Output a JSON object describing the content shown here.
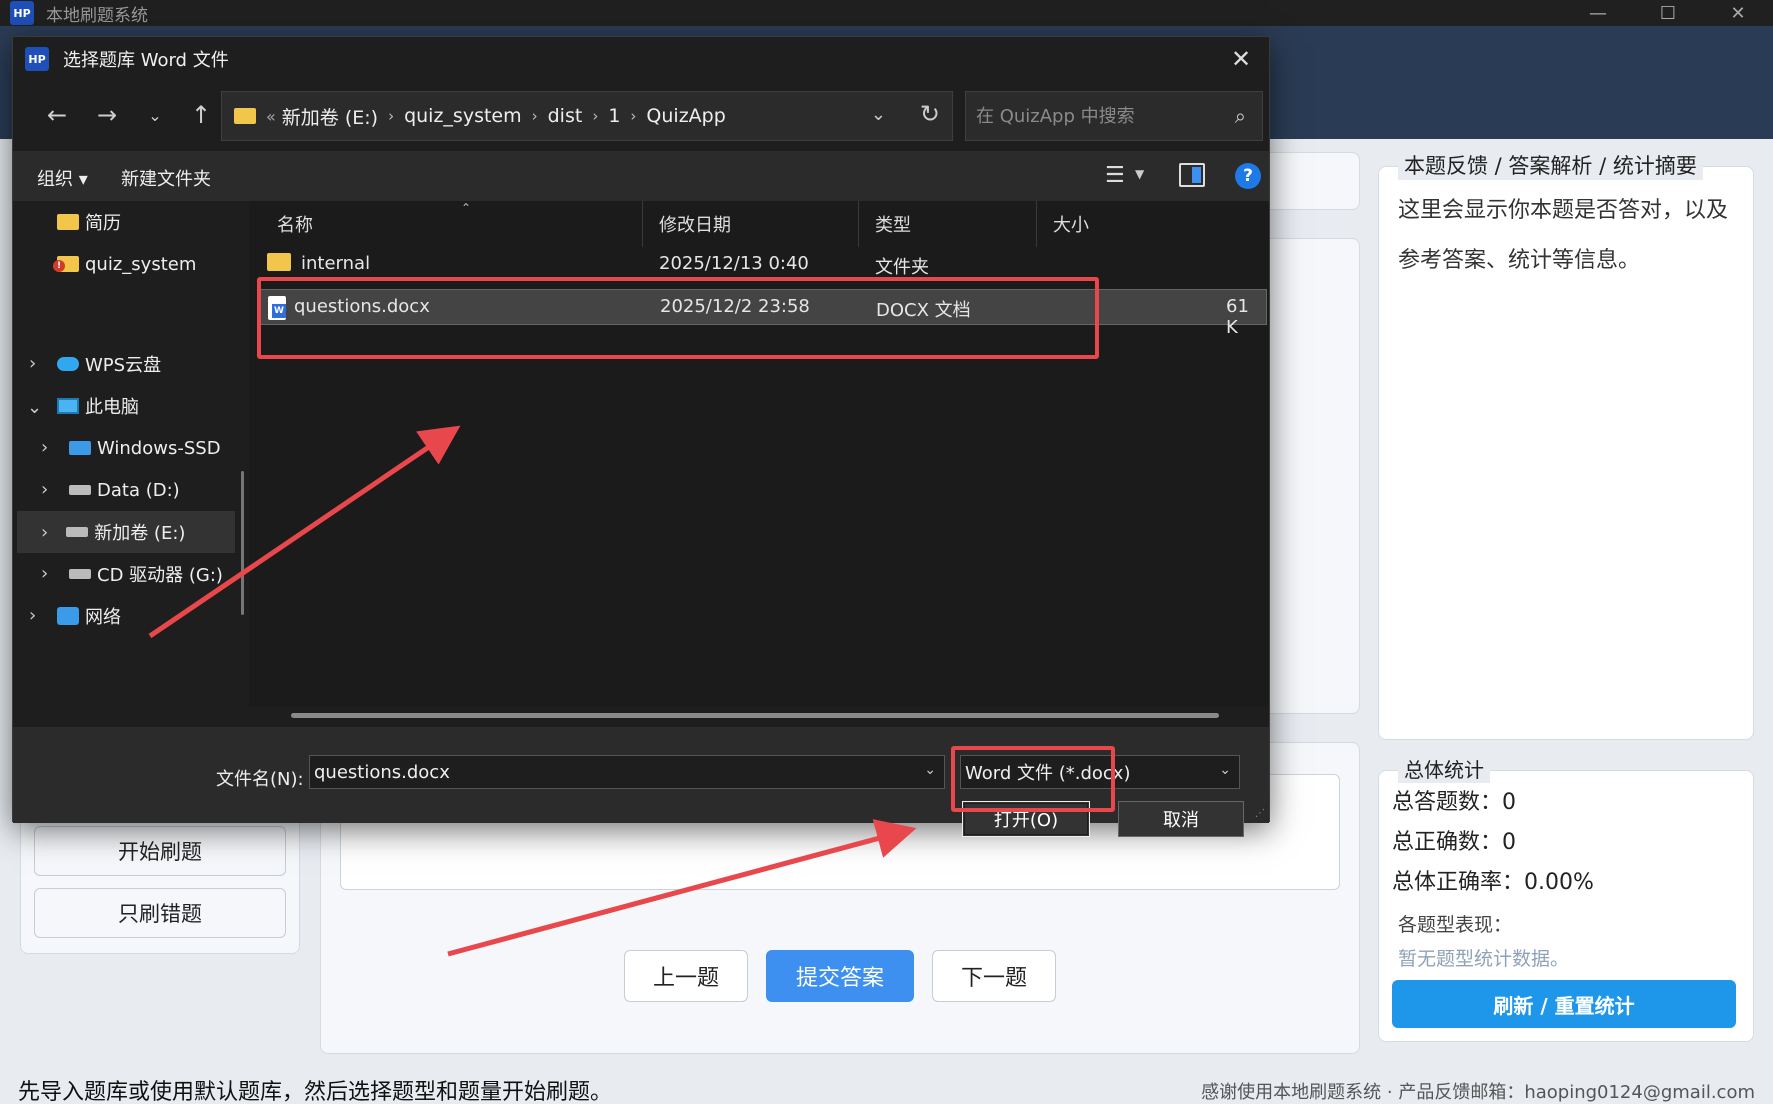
{
  "app": {
    "logo": "HP",
    "title": "本地刷题系统",
    "window_controls": [
      "—",
      "☐",
      "✕"
    ]
  },
  "left_panel": {
    "start_button": "开始刷题",
    "wrong_only_button": "只刷错题"
  },
  "nav_buttons": {
    "prev": "上一题",
    "submit": "提交答案",
    "next": "下一题"
  },
  "feedback": {
    "title": "本题反馈 / 答案解析 / 统计摘要",
    "text": "这里会显示你本题是否答对，以及参考答案、统计等信息。"
  },
  "stats": {
    "title": "总体统计",
    "total_answered": "总答题数：0",
    "total_correct": "总正确数：0",
    "accuracy": "总体正确率：0.00%",
    "by_type_label": "各题型表现：",
    "by_type_empty": "暂无题型统计数据。",
    "refresh_button": "刷新 / 重置统计"
  },
  "status_bar": {
    "left": "先导入题库或使用默认题库，然后选择题型和题量开始刷题。",
    "right": "感谢使用本地刷题系统 · 产品反馈邮箱：haoping0124@gmail.com"
  },
  "dialog": {
    "logo": "HP",
    "title": "选择题库 Word 文件",
    "nav_icons": [
      "back-icon",
      "forward-icon",
      "recent-icon",
      "up-icon"
    ],
    "breadcrumb": [
      "新加卷 (E:)",
      "quiz_system",
      "dist",
      "1",
      "QuizApp"
    ],
    "breadcrumb_prefix": "«",
    "search_placeholder": "在 QuizApp 中搜索",
    "toolbar": {
      "organize": "组织 ▾",
      "new_folder": "新建文件夹",
      "help": "?"
    },
    "nav_pane": [
      {
        "label": "简历",
        "icon": "folder-icon"
      },
      {
        "label": "quiz_system",
        "icon": "folder-warning-icon"
      },
      {
        "label": "WPS云盘",
        "icon": "cloud-icon"
      },
      {
        "label": "此电脑",
        "icon": "computer-icon"
      },
      {
        "label": "Windows-SSD",
        "icon": "windows-drive-icon"
      },
      {
        "label": "Data (D:)",
        "icon": "drive-icon"
      },
      {
        "label": "新加卷 (E:)",
        "icon": "drive-icon"
      },
      {
        "label": "CD 驱动器 (G:)",
        "icon": "cd-drive-icon"
      },
      {
        "label": "网络",
        "icon": "network-icon"
      }
    ],
    "columns": [
      "名称",
      "修改日期",
      "类型",
      "大小"
    ],
    "files": [
      {
        "name": "internal",
        "date": "2025/12/13 0:40",
        "type": "文件夹",
        "size": ""
      },
      {
        "name": "questions.docx",
        "date": "2025/12/2 23:58",
        "type": "DOCX 文档",
        "size": "61 K"
      }
    ],
    "filename_label": "文件名(N):",
    "filename_value": "questions.docx",
    "filetype": "Word 文件 (*.docx)",
    "open_button": "打开(O)",
    "cancel_button": "取消"
  },
  "colors": {
    "dialog_bg": "#1e1e1e",
    "annotation": "#e8474c",
    "accent": "#3d8ff0",
    "refresh": "#1e96ea"
  }
}
